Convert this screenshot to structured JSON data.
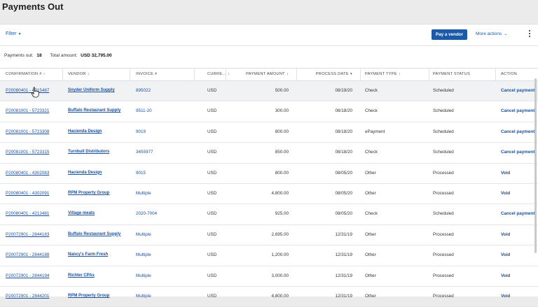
{
  "page": {
    "title": "Payments Out"
  },
  "toolbar": {
    "filter_label": "Filter",
    "pay_button": "Pay a vendor",
    "more_actions": "More actions"
  },
  "summary": {
    "payments_out_label": "Payments out:",
    "payments_out_count": "18",
    "total_label": "Total amount:",
    "total_value": "USD 32,795.00"
  },
  "columns": [
    {
      "label": "CONFIRMATION #",
      "sort": "↕"
    },
    {
      "label": "VENDOR",
      "sort": "↕"
    },
    {
      "label": "INVOICE #",
      "sort": ""
    },
    {
      "label": "CURRE...",
      "sort": "↕"
    },
    {
      "label": "PAYMENT AMOUNT",
      "sort": "↕"
    },
    {
      "label": "PROCESS DATE",
      "sort": "▾"
    },
    {
      "label": "PAYMENT TYPE",
      "sort": "↕"
    },
    {
      "label": "PAYMENT STATUS",
      "sort": ""
    },
    {
      "label": "ACTION",
      "sort": ""
    }
  ],
  "rows": [
    {
      "confirmation": "P20080401 - 4215487",
      "vendor": "Snyder Uniform Supply",
      "invoice": "895022",
      "currency": "USD",
      "amount": "500.00",
      "date": "08/19/20",
      "type": "Check",
      "status": "Scheduled",
      "action": "Cancel payment"
    },
    {
      "confirmation": "P20081001 - 5723321",
      "vendor": "Buffalo Restaurant Supply",
      "invoice": "9511-20",
      "currency": "USD",
      "amount": "300.00",
      "date": "08/18/20",
      "type": "Check",
      "status": "Scheduled",
      "action": "Cancel payment"
    },
    {
      "confirmation": "P20081001 - 5723308",
      "vendor": "Hacienda Design",
      "invoice": "9019",
      "currency": "USD",
      "amount": "800.00",
      "date": "08/18/20",
      "type": "ePayment",
      "status": "Scheduled",
      "action": "Cancel payment"
    },
    {
      "confirmation": "P20081001 - 5723315",
      "vendor": "Turnbull Distributors",
      "invoice": "3455977",
      "currency": "USD",
      "amount": "850.00",
      "date": "08/18/20",
      "type": "Check",
      "status": "Scheduled",
      "action": "Cancel payment"
    },
    {
      "confirmation": "P20080401 - 4302083",
      "vendor": "Hacienda Design",
      "invoice": "9015",
      "currency": "USD",
      "amount": "800.00",
      "date": "08/05/20",
      "type": "Other",
      "status": "Processed",
      "action": "Void"
    },
    {
      "confirmation": "P20080401 - 4302091",
      "vendor": "RPM Property Group",
      "invoice": "Multiple",
      "currency": "USD",
      "amount": "4,800.00",
      "date": "08/05/20",
      "type": "Other",
      "status": "Processed",
      "action": "Void"
    },
    {
      "confirmation": "P20080401 - 4213481",
      "vendor": "Village meats",
      "invoice": "2020-7004",
      "currency": "USD",
      "amount": "925.00",
      "date": "08/05/20",
      "type": "Check",
      "status": "Scheduled",
      "action": "Cancel payment"
    },
    {
      "confirmation": "P20072901 - 2844183",
      "vendor": "Buffalo Restaurant Supply",
      "invoice": "Multiple",
      "currency": "USD",
      "amount": "2,695.00",
      "date": "12/31/19",
      "type": "Other",
      "status": "Processed",
      "action": "Void"
    },
    {
      "confirmation": "P20072901 - 2844188",
      "vendor": "Nancy's Farm Fresh",
      "invoice": "Multiple",
      "currency": "USD",
      "amount": "1,200.00",
      "date": "12/31/19",
      "type": "Other",
      "status": "Processed",
      "action": "Void"
    },
    {
      "confirmation": "P20072901 - 2844194",
      "vendor": "Richter CPAs",
      "invoice": "Multiple",
      "currency": "USD",
      "amount": "3,000.00",
      "date": "12/31/19",
      "type": "Other",
      "status": "Processed",
      "action": "Void"
    },
    {
      "confirmation": "P20072901 - 2844201",
      "vendor": "RPM Property Group",
      "invoice": "Multiple",
      "currency": "USD",
      "amount": "4,800.00",
      "date": "12/31/19",
      "type": "Other",
      "status": "Processed",
      "action": "Void"
    }
  ]
}
